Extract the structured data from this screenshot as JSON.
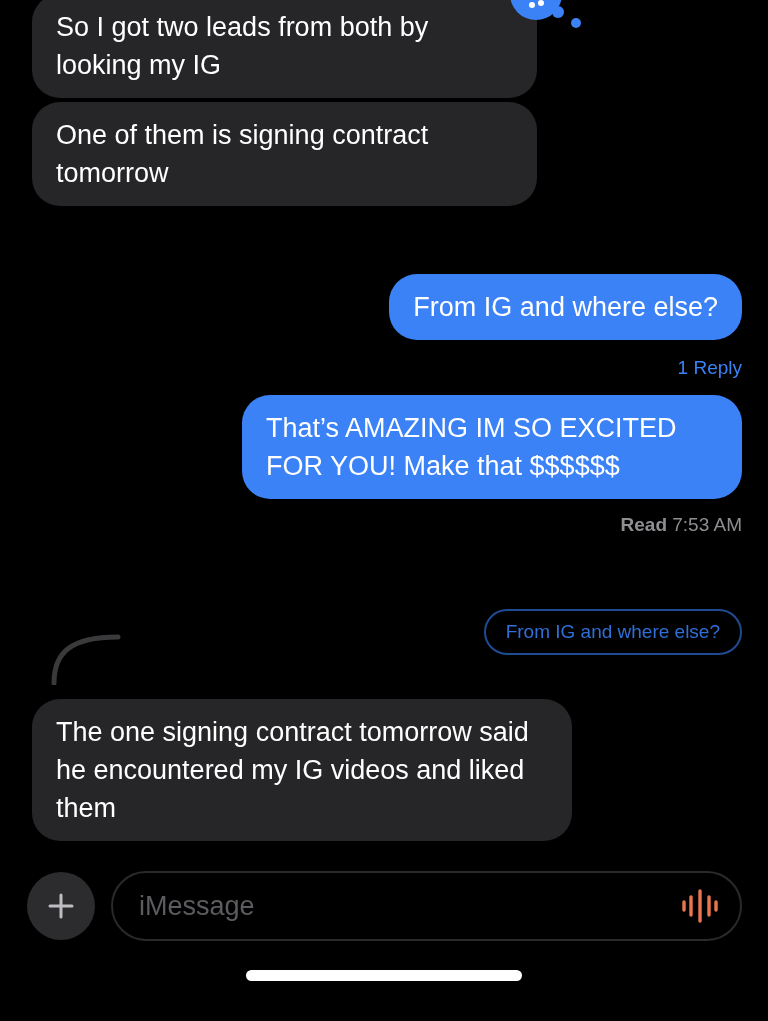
{
  "messages": [
    {
      "kind": "received",
      "text": "So I got two leads from both by looking my IG"
    },
    {
      "kind": "received",
      "text": "One of them is signing contract tomorrow"
    },
    {
      "kind": "sent",
      "text": "From IG and where else?"
    },
    {
      "kind": "reply_count",
      "text": "1 Reply"
    },
    {
      "kind": "sent",
      "text": "That’s AMAZING IM SO EXCITED FOR YOU! Make that $$$$$$"
    },
    {
      "kind": "read_receipt",
      "label": "Read",
      "time": "7:53 AM"
    },
    {
      "kind": "quoted",
      "text": "From IG and where else?"
    },
    {
      "kind": "received",
      "text": "The one signing contract tomorrow said he encountered my IG videos and liked them"
    }
  ],
  "composer": {
    "placeholder": "iMessage"
  }
}
